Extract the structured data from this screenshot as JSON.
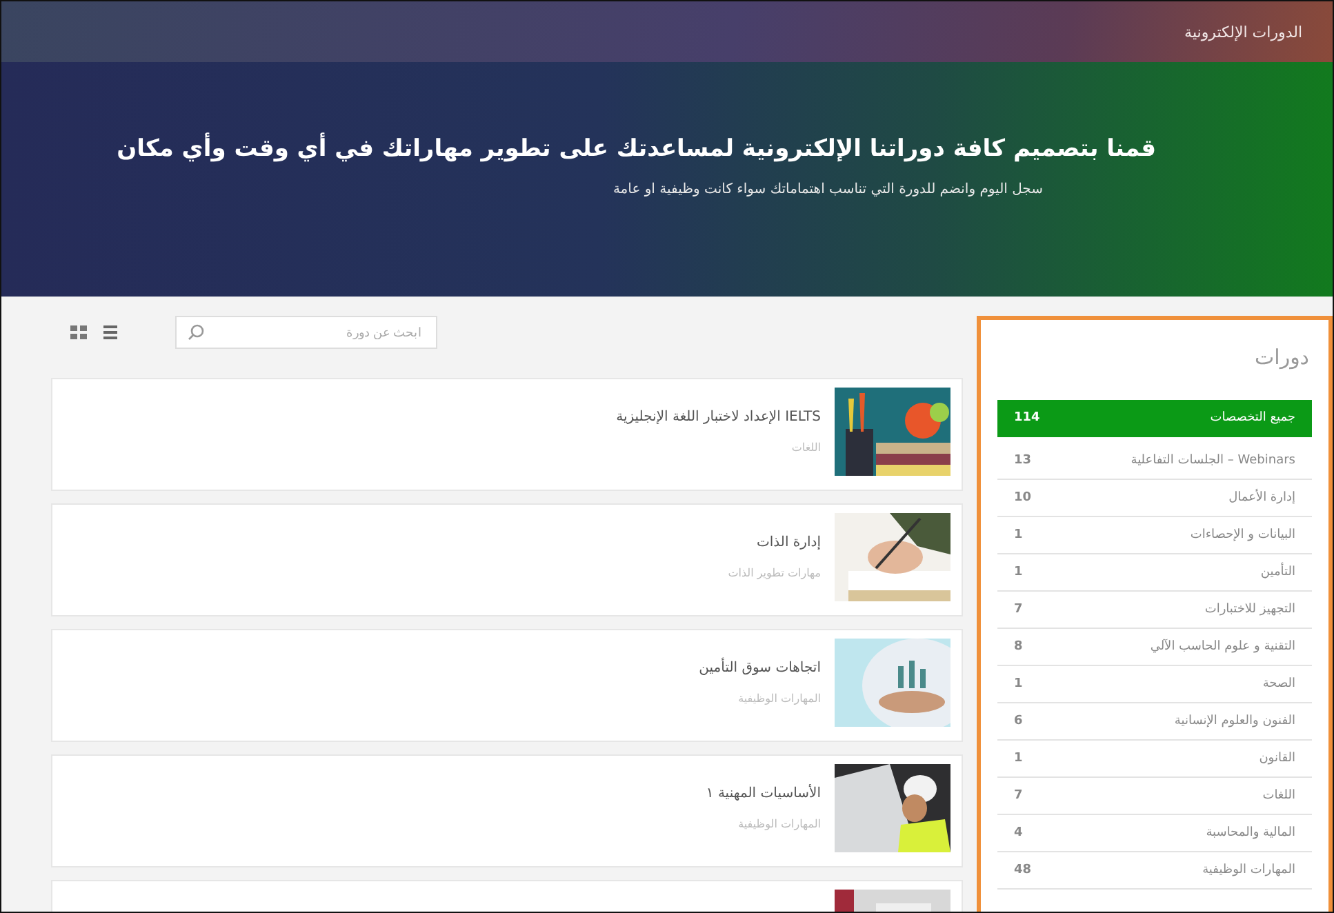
{
  "breadcrumb": "الدورات الإلكترونية",
  "hero": {
    "title": "قمنا بتصميم كافة دوراتنا الإلكترونية لمساعدتك على تطوير مهاراتك في أي وقت وأي مكان",
    "subtitle": "سجل اليوم وانضم للدورة التي تناسب اهتماماتك سواء كانت وظيفية او عامة"
  },
  "sidebar": {
    "title": "دورات",
    "items": [
      {
        "label": "جميع التخصصات",
        "count": "114",
        "selected": true
      },
      {
        "label": "Webinars – الجلسات التفاعلية",
        "count": "13",
        "selected": false
      },
      {
        "label": "إدارة الأعمال",
        "count": "10",
        "selected": false
      },
      {
        "label": "البيانات و الإحصاءات",
        "count": "1",
        "selected": false
      },
      {
        "label": "التأمين",
        "count": "1",
        "selected": false
      },
      {
        "label": "التجهيز للاختبارات",
        "count": "7",
        "selected": false
      },
      {
        "label": "التقنية و علوم الحاسب الآلي",
        "count": "8",
        "selected": false
      },
      {
        "label": "الصحة",
        "count": "1",
        "selected": false
      },
      {
        "label": "الفنون والعلوم الإنسانية",
        "count": "6",
        "selected": false
      },
      {
        "label": "القانون",
        "count": "1",
        "selected": false
      },
      {
        "label": "اللغات",
        "count": "7",
        "selected": false
      },
      {
        "label": "المالية والمحاسبة",
        "count": "4",
        "selected": false
      },
      {
        "label": "المهارات الوظيفية",
        "count": "48",
        "selected": false
      }
    ]
  },
  "search": {
    "placeholder": "ابحث عن دورة"
  },
  "courses": [
    {
      "kind": "course",
      "title": "IELTS الإعداد لاختبار اللغة الإنجليزية",
      "category": "اللغات"
    },
    {
      "kind": "course",
      "title": "إدارة الذات",
      "category": "مهارات تطوير الذات"
    },
    {
      "kind": "course",
      "title": "اتجاهات سوق التأمين",
      "category": "المهارات الوظيفية"
    },
    {
      "kind": "course",
      "title": "الأساسيات المهنية ١",
      "category": "المهارات الوظيفية"
    },
    {
      "kind": "picture"
    }
  ]
}
